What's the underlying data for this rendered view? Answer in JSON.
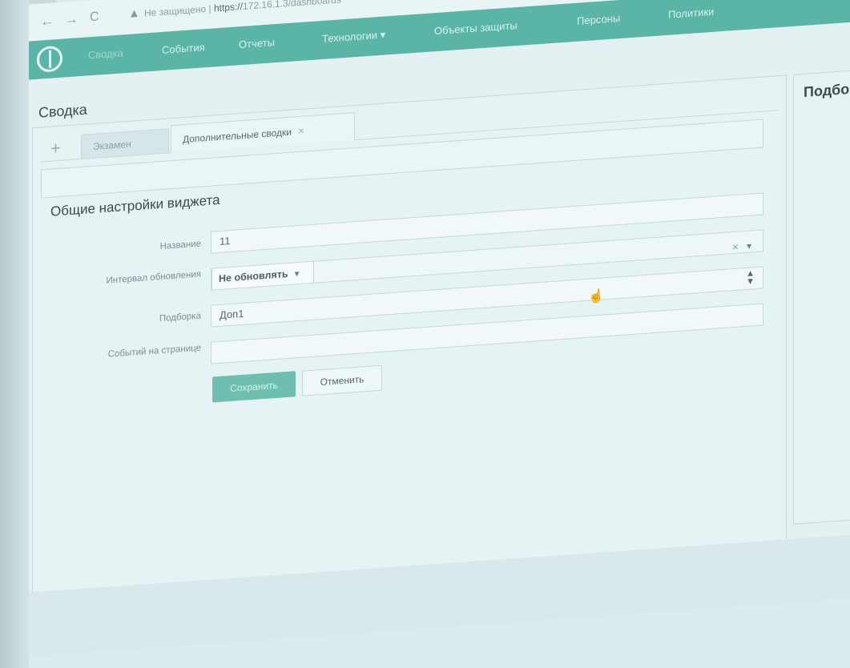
{
  "browser": {
    "tab_title": "",
    "nav_back": "←",
    "nav_forward": "→",
    "reload": "C",
    "security_text": "Не защищено",
    "url_scheme": "https://",
    "url_rest": "172.16.1.3/dashboards"
  },
  "navbar": {
    "items": [
      {
        "label": "Сводка",
        "active": true
      },
      {
        "label": "События"
      },
      {
        "label": "Отчеты"
      },
      {
        "label": "Технологии ▾"
      },
      {
        "label": "Объекты защиты"
      },
      {
        "label": "Персоны"
      },
      {
        "label": "Политики"
      }
    ]
  },
  "page": {
    "title": "Сводка",
    "right_panel_title": "Подбо"
  },
  "tabs": {
    "add": "+",
    "items": [
      {
        "label": "Экзамен"
      },
      {
        "label": "Дополнительные сводки",
        "close": "×"
      }
    ]
  },
  "form": {
    "section_title": "Общие настройки виджета",
    "name_label": "Название",
    "name_value": "11",
    "interval_label": "Интервал обновления",
    "interval_value": "Не обновлять",
    "interval_clear": "×",
    "selection_label": "Подборка",
    "selection_value": "Доп1",
    "per_page_label": "Событий на странице",
    "per_page_value": "",
    "save_label": "Сохранить",
    "cancel_label": "Отменить"
  },
  "colors": {
    "accent": "#5ab5a6",
    "background": "#e3f1f2"
  }
}
